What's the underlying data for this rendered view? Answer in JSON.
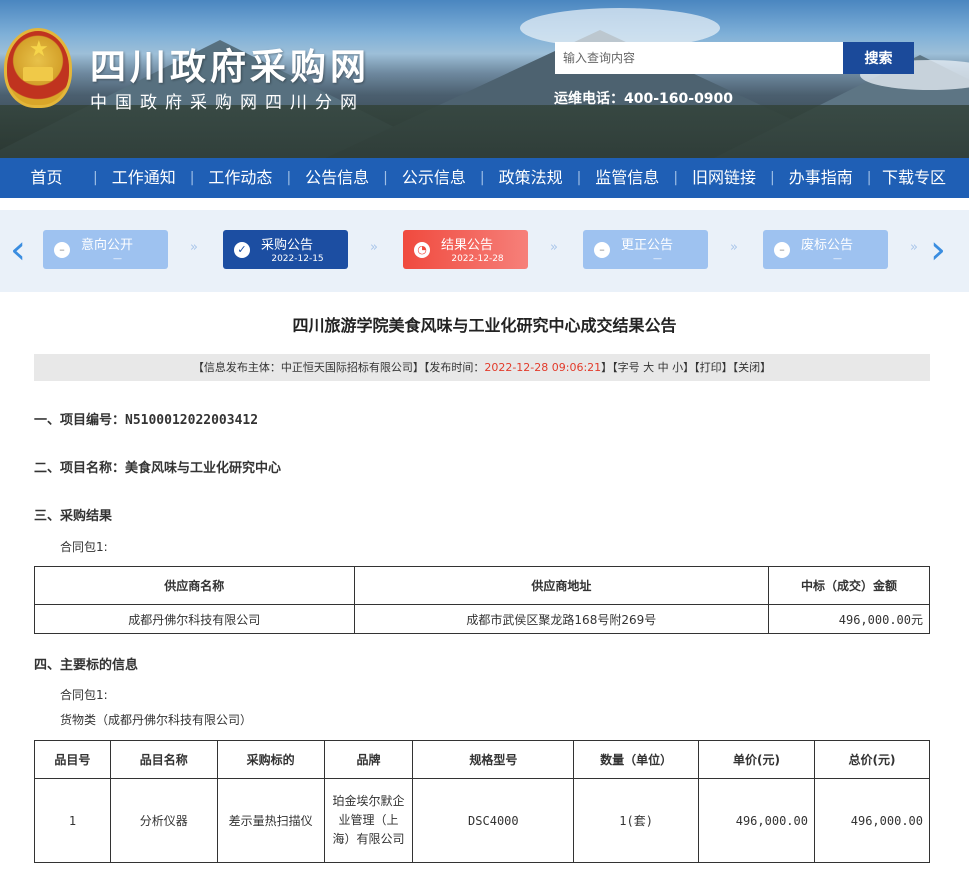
{
  "header": {
    "title": "四川政府采购网",
    "subtitle": "中国政府采购网四川分网",
    "search_placeholder": "输入查询内容",
    "search_button": "搜索",
    "hotline": "运维电话：400-160-0900"
  },
  "nav": [
    "首页",
    "工作通知",
    "工作动态",
    "公告信息",
    "公示信息",
    "政策法规",
    "监管信息",
    "旧网链接",
    "办事指南",
    "下载专区"
  ],
  "steps": [
    {
      "label": "意向公开",
      "date": "—",
      "style": "pale",
      "icon": "minus-icon"
    },
    {
      "label": "采购公告",
      "date": "2022-12-15",
      "style": "dark",
      "icon": "check-icon"
    },
    {
      "label": "结果公告",
      "date": "2022-12-28",
      "style": "red",
      "icon": "clock-icon"
    },
    {
      "label": "更正公告",
      "date": "—",
      "style": "pale",
      "icon": "minus-icon"
    },
    {
      "label": "废标公告",
      "date": "—",
      "style": "pale",
      "icon": "minus-icon"
    }
  ],
  "article": {
    "title": "四川旅游学院美食风味与工业化研究中心成交结果公告",
    "info_prefix": "【信息发布主体：中正恒天国际招标有限公司】【发布时间：",
    "info_time": "2022-12-28 09:06:21",
    "info_suffix": "】【字号 大 中 小】【打印】【关闭】",
    "sec1": "一、项目编号：N5100012022003412",
    "sec2": "二、项目名称：美食风味与工业化研究中心",
    "sec3": "三、采购结果",
    "package1": "合同包1:",
    "sec4": "四、主要标的信息",
    "package2": "合同包1:",
    "goods": "货物类（成都丹佛尔科技有限公司）"
  },
  "result_table": {
    "headers": [
      "供应商名称",
      "供应商地址",
      "中标（成交）金额"
    ],
    "rows": [
      [
        "成都丹佛尔科技有限公司",
        "成都市武侯区聚龙路168号附269号",
        "496,000.00元"
      ]
    ]
  },
  "item_table": {
    "headers": [
      "品目号",
      "品目名称",
      "采购标的",
      "品牌",
      "规格型号",
      "数量（单位）",
      "单价(元)",
      "总价(元)"
    ],
    "rows": [
      [
        "1",
        "分析仪器",
        "差示量热扫描仪",
        "珀金埃尔默企业管理（上海）有限公司",
        "DSC4000",
        "1(套)",
        "496,000.00",
        "496,000.00"
      ]
    ]
  }
}
